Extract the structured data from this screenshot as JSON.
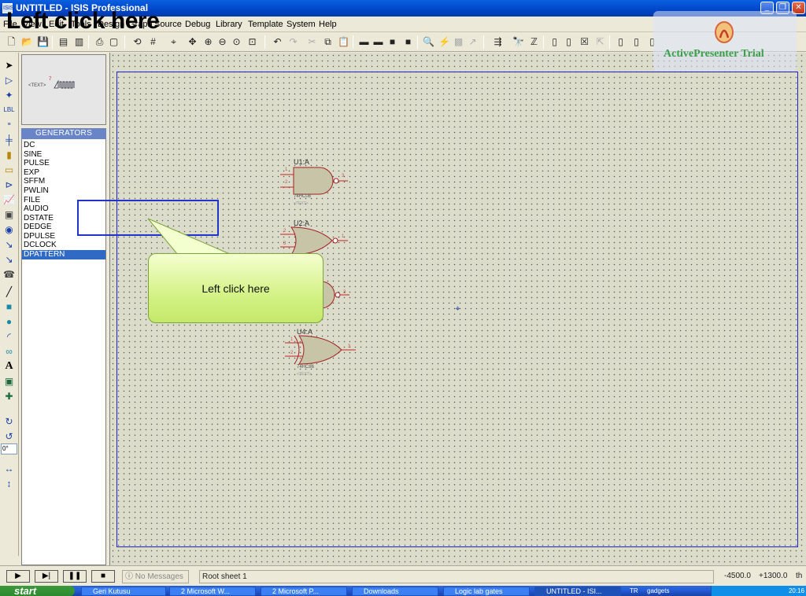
{
  "window": {
    "app_icon": "ISIS",
    "title": "UNTITLED - ISIS Professional",
    "controls": [
      "minimize-icon",
      "restore-icon",
      "close-icon"
    ]
  },
  "menu": [
    "File",
    "View",
    "Edit",
    "Tools",
    "Design",
    "Graph",
    "Source",
    "Debug",
    "Library",
    "Template",
    "System",
    "Help"
  ],
  "overview": {
    "text_label": "<TEXT>",
    "digit": "7"
  },
  "devices": {
    "header": "GENERATORS",
    "items": [
      "DC",
      "SINE",
      "PULSE",
      "EXP",
      "SFFM",
      "PWLIN",
      "FILE",
      "AUDIO",
      "DSTATE",
      "DEDGE",
      "DPULSE",
      "DCLOCK",
      "DPATTERN"
    ],
    "selected": "DPATTERN"
  },
  "rotation": "0°",
  "gates": [
    {
      "ref": "U1:A",
      "type": "AND",
      "part": "74HC08",
      "text": "<TEXT>",
      "pins": [
        "1",
        "2",
        "3"
      ]
    },
    {
      "ref": "U2:A",
      "type": "OR",
      "part": "",
      "text": "",
      "pins": [
        "2",
        "3",
        "1"
      ]
    },
    {
      "ref": "",
      "type": "partial",
      "part": "",
      "text": "",
      "pins": [
        "3"
      ]
    },
    {
      "ref": "U4:A",
      "type": "XOR",
      "part": "74HC86",
      "text": "<TEXT>",
      "pins": [
        "1",
        "2",
        "3"
      ]
    }
  ],
  "overlay": {
    "title": "Left click here",
    "callout": "Left click here",
    "watermark": "ActivePresenter Trial",
    "highlight_color": "#2233cc",
    "callout_color": "#d4f286"
  },
  "status": {
    "messages": "No Messages",
    "sheet": "Root sheet 1",
    "coord_x": "-4500.0",
    "coord_y": "+1300.0",
    "unit": "th"
  },
  "taskbar": {
    "start": "start",
    "tasks": [
      "Geri Kutusu",
      "2 Microsoft W...",
      "2 Microsoft P...",
      "Downloads",
      "Logic lab gates",
      "UNTITLED - ISI..."
    ],
    "tray": [
      "TR",
      "gadgets",
      "20:16"
    ]
  }
}
